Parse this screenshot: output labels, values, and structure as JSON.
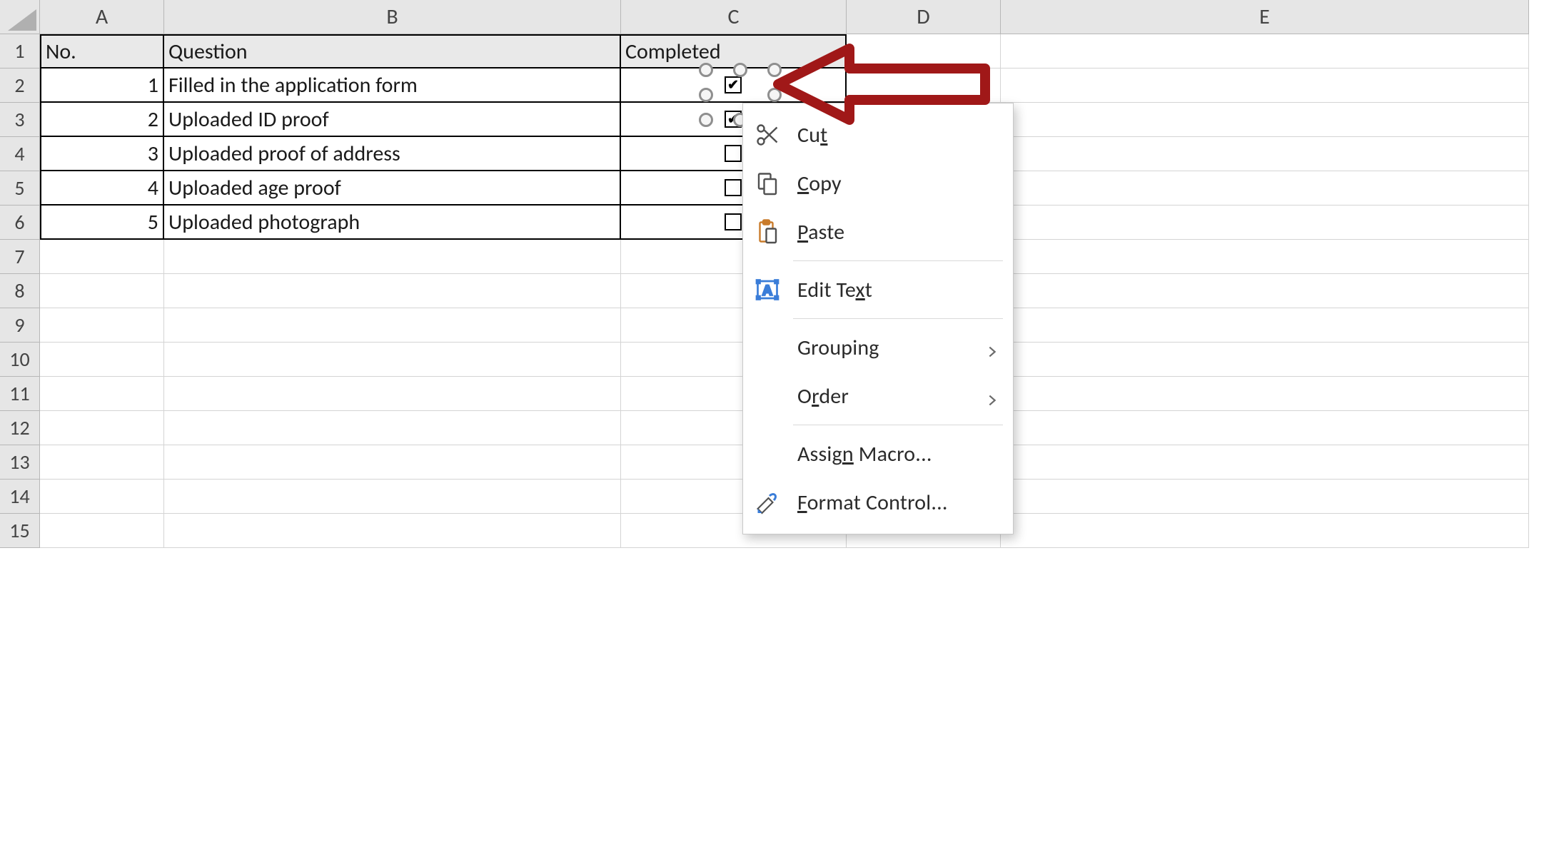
{
  "columns": [
    "A",
    "B",
    "C",
    "D",
    "E"
  ],
  "row_numbers": [
    1,
    2,
    3,
    4,
    5,
    6,
    7,
    8,
    9,
    10,
    11,
    12,
    13,
    14,
    15
  ],
  "table": {
    "headers": {
      "a": "No.",
      "b": "Question",
      "c": "Completed"
    },
    "rows": [
      {
        "no": "1",
        "question": "Filled in the application form",
        "checked": true
      },
      {
        "no": "2",
        "question": "Uploaded ID proof",
        "checked": true
      },
      {
        "no": "3",
        "question": "Uploaded proof of address",
        "checked": false
      },
      {
        "no": "4",
        "question": "Uploaded age proof",
        "checked": false
      },
      {
        "no": "5",
        "question": "Uploaded photograph",
        "checked": false
      }
    ]
  },
  "context_menu": {
    "cut": "Cut",
    "copy": "Copy",
    "paste": "Paste",
    "edit_text": "Edit Text",
    "grouping": "Grouping",
    "order": "Order",
    "assign_macro": "Assign Macro...",
    "format_control": "Format Control..."
  }
}
